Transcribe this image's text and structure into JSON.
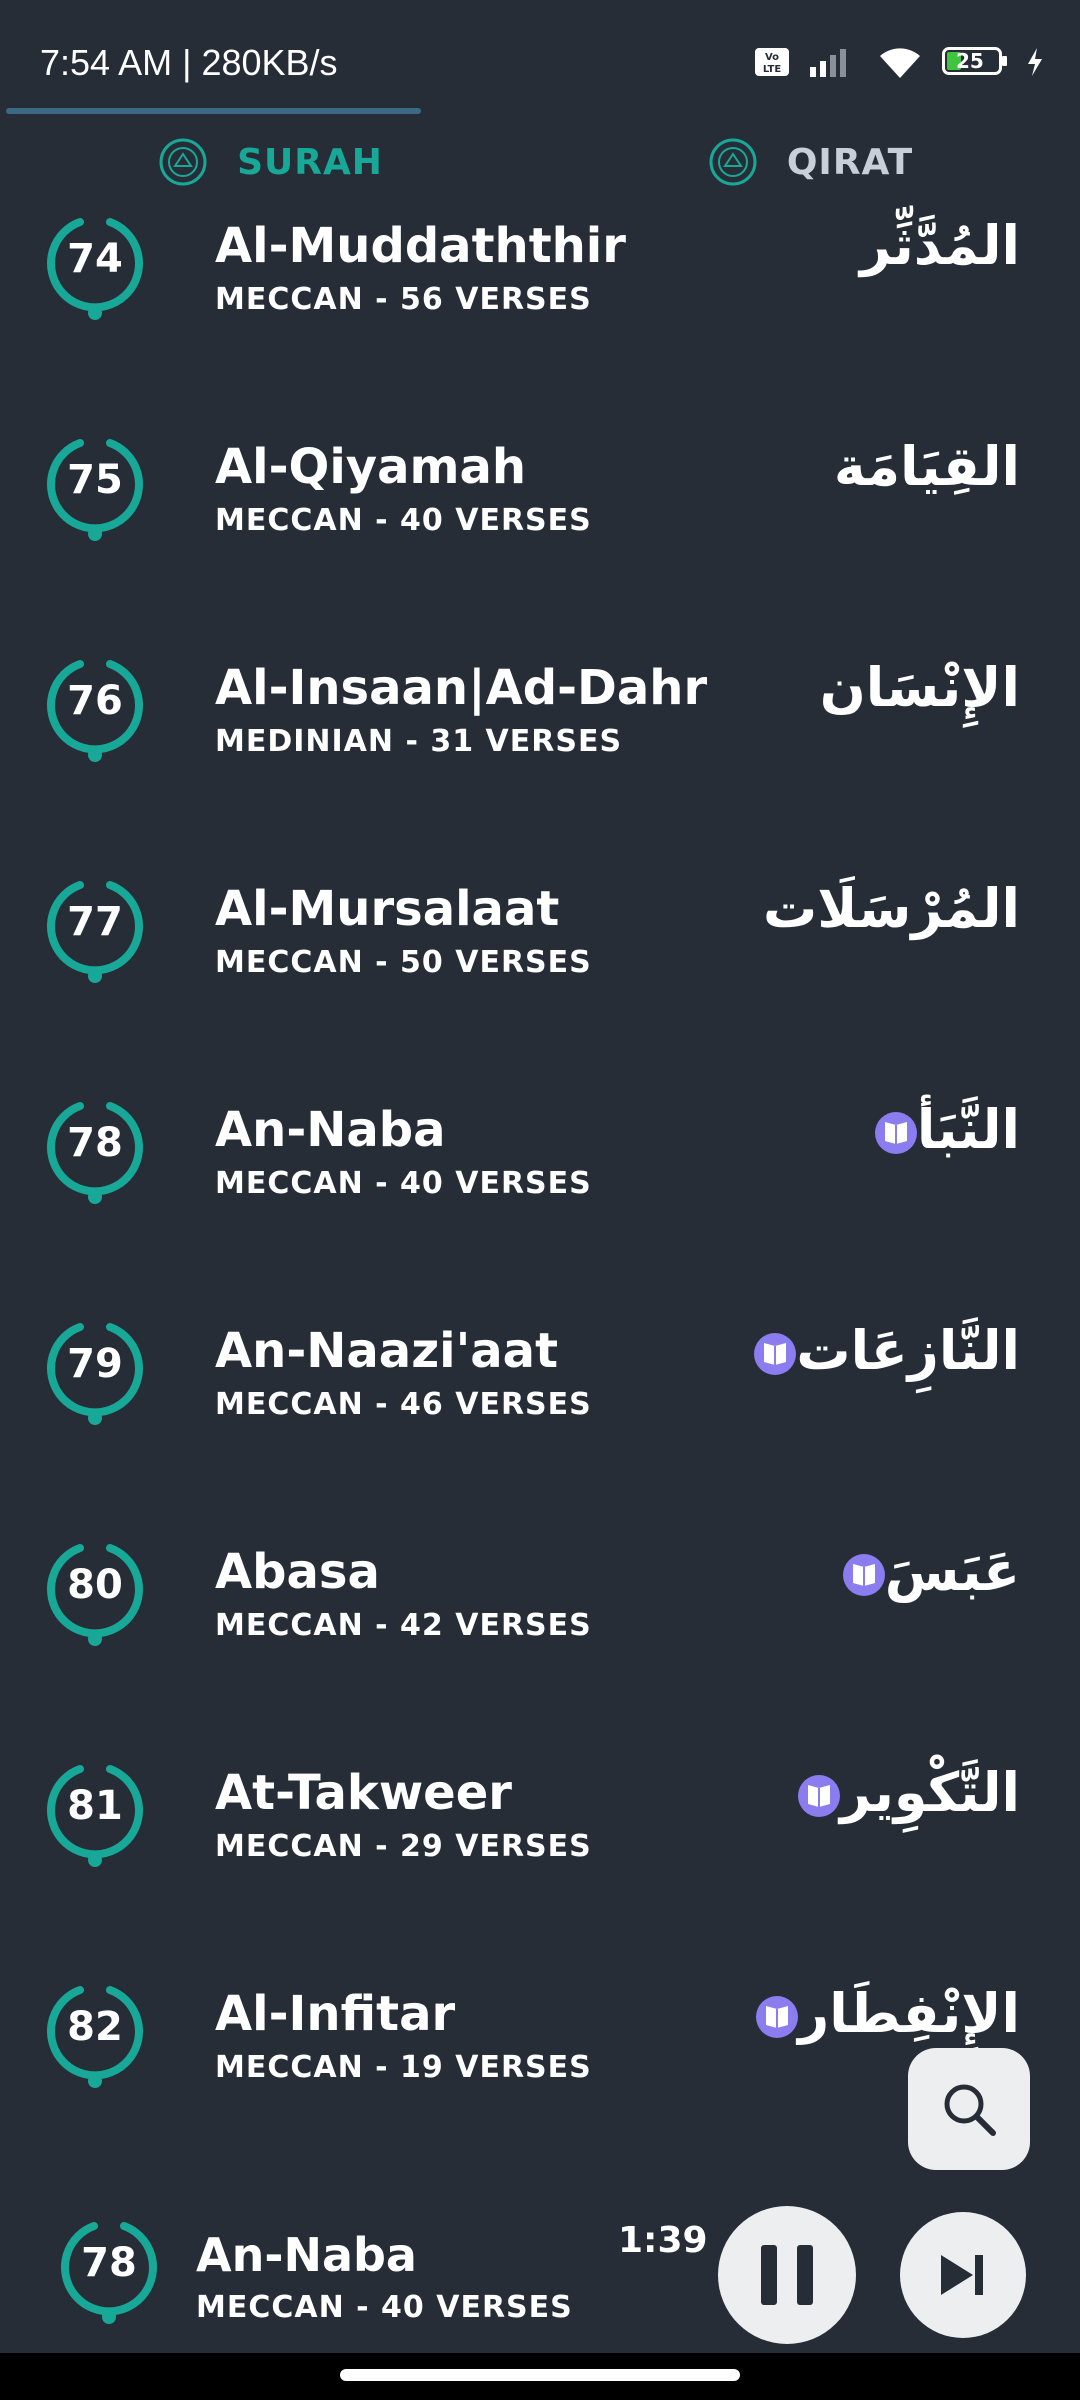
{
  "status": {
    "time_speed": "7:54 AM | 280KB/s",
    "battery": "25"
  },
  "tabs": [
    {
      "label": "SURAH",
      "active": true
    },
    {
      "label": "QIRAT",
      "active": false
    }
  ],
  "colors": {
    "accent": "#18a898",
    "background": "#272d37",
    "book_badge": "#8b7cf0"
  },
  "surahs": [
    {
      "number": "74",
      "name": "Al-Muddaththir",
      "meta": "MECCAN - 56 VERSES",
      "arabic": "المُدَّثِّر",
      "book_icon": false
    },
    {
      "number": "75",
      "name": "Al-Qiyamah",
      "meta": "MECCAN - 40 VERSES",
      "arabic": "القِيَامَة",
      "book_icon": false
    },
    {
      "number": "76",
      "name": "Al-Insaan|Ad-Dahr",
      "meta": "MEDINIAN - 31 VERSES",
      "arabic": "الإِنْسَان",
      "book_icon": false
    },
    {
      "number": "77",
      "name": "Al-Mursalaat",
      "meta": "MECCAN - 50 VERSES",
      "arabic": "المُرْسَلَات",
      "book_icon": false
    },
    {
      "number": "78",
      "name": "An-Naba",
      "meta": "MECCAN - 40 VERSES",
      "arabic": "النَّبَأ",
      "book_icon": true
    },
    {
      "number": "79",
      "name": "An-Naazi'aat",
      "meta": "MECCAN - 46 VERSES",
      "arabic": "النَّازِعَات",
      "book_icon": true
    },
    {
      "number": "80",
      "name": "Abasa",
      "meta": "MECCAN - 42 VERSES",
      "arabic": "عَبَسَ",
      "book_icon": true
    },
    {
      "number": "81",
      "name": "At-Takweer",
      "meta": "MECCAN - 29 VERSES",
      "arabic": "التَّكْوِير",
      "book_icon": true
    },
    {
      "number": "82",
      "name": "Al-Infitar",
      "meta": "MECCAN - 19 VERSES",
      "arabic": "الإِنْفِطَار",
      "book_icon": true
    }
  ],
  "player": {
    "number": "78",
    "title": "An-Naba",
    "meta": "MECCAN - 40 VERSES",
    "elapsed": "1:39"
  },
  "icons": {
    "search": "search-icon",
    "pause": "pause-icon",
    "next": "skip-next-icon",
    "book": "book-icon"
  }
}
